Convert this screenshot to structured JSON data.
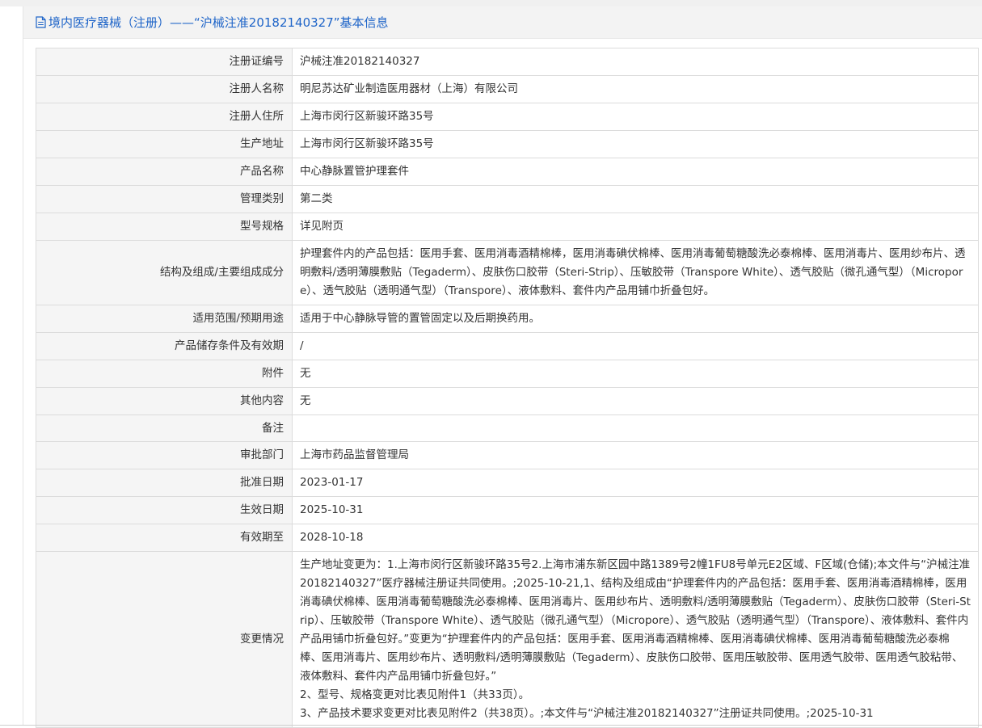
{
  "header": {
    "title": "境内医疗器械（注册）——“沪械注准20182140327”基本信息"
  },
  "rows": [
    {
      "label": "注册证编号",
      "value": "沪械注准20182140327"
    },
    {
      "label": "注册人名称",
      "value": "明尼苏达矿业制造医用器材（上海）有限公司"
    },
    {
      "label": "注册人住所",
      "value": "上海市闵行区新骏环路35号"
    },
    {
      "label": "生产地址",
      "value": "上海市闵行区新骏环路35号"
    },
    {
      "label": "产品名称",
      "value": "中心静脉置管护理套件"
    },
    {
      "label": "管理类别",
      "value": "第二类"
    },
    {
      "label": "型号规格",
      "value": "详见附页"
    },
    {
      "label": "结构及组成/主要组成成分",
      "value": "护理套件内的产品包括：医用手套、医用消毒酒精棉棒，医用消毒碘伏棉棒、医用消毒葡萄糖酸洗必泰棉棒、医用消毒片、医用纱布片、透明敷料/透明薄膜敷贴（Tegaderm）、皮肤伤口胶带（Steri-Strip）、压敏胶带（Transpore White）、透气胶贴（微孔通气型）（Micropore）、透气胶贴（透明通气型）（Transpore）、液体敷料、套件内产品用铺巾折叠包好。"
    },
    {
      "label": "适用范围/预期用途",
      "value": "适用于中心静脉导管的置管固定以及后期换药用。"
    },
    {
      "label": "产品储存条件及有效期",
      "value": "/"
    },
    {
      "label": "附件",
      "value": "无"
    },
    {
      "label": "其他内容",
      "value": "无"
    },
    {
      "label": "备注",
      "value": ""
    },
    {
      "label": "审批部门",
      "value": "上海市药品监督管理局"
    },
    {
      "label": "批准日期",
      "value": "2023-01-17"
    },
    {
      "label": "生效日期",
      "value": "2025-10-31"
    },
    {
      "label": "有效期至",
      "value": "2028-10-18"
    }
  ],
  "change": {
    "label": "变更情况",
    "lines": [
      "生产地址变更为：1.上海市闵行区新骏环路35号2.上海市浦东新区园中路1389号2幢1FU8号单元E2区域、F区域(仓储);本文件与“沪械注准20182140327”医疗器械注册证共同使用。;2025-10-21,1、结构及组成由“护理套件内的产品包括：医用手套、医用消毒酒精棉棒，医用消毒碘伏棉棒、医用消毒葡萄糖酸洗必泰棉棒、医用消毒片、医用纱布片、透明敷料/透明薄膜敷贴（Tegaderm）、皮肤伤口胶带（Steri-Strip）、压敏胶带（Transpore White）、透气胶贴（微孔通气型）（Micropore）、透气胶贴（透明通气型）（Transpore）、液体敷料、套件内产品用铺巾折叠包好。”变更为“护理套件内的产品包括：医用手套、医用消毒酒精棉棒、医用消毒碘伏棉棒、医用消毒葡萄糖酸洗必泰棉棒、医用消毒片、医用纱布片、透明敷料/透明薄膜敷贴（Tegaderm）、皮肤伤口胶带、医用压敏胶带、医用透气胶带、医用透气胶粘带、液体敷料、套件内产品用铺巾折叠包好。”",
      "2、型号、规格变更对比表见附件1（共33页）。",
      "3、产品技术要求变更对比表见附件2（共38页）。;本文件与“沪械注准20182140327”注册证共同使用。;2025-10-31"
    ]
  }
}
